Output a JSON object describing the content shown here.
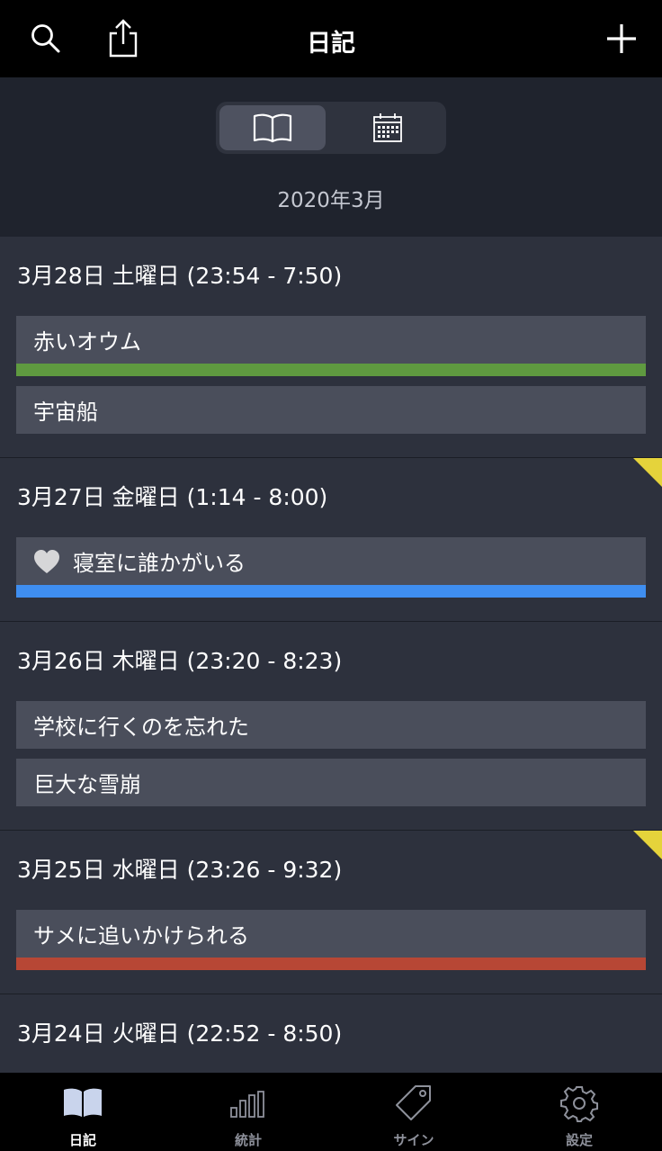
{
  "nav": {
    "title": "日記"
  },
  "header": {
    "month": "2020年3月"
  },
  "days": [
    {
      "title": "3月28日 土曜日 (23:54 - 7:50)",
      "flag": false,
      "dreams": [
        {
          "label": "赤いオウム",
          "bar_color": "#5f9a40",
          "heart": false
        },
        {
          "label": "宇宙船",
          "bar_color": null,
          "heart": false
        }
      ]
    },
    {
      "title": "3月27日 金曜日 (1:14 - 8:00)",
      "flag": true,
      "dreams": [
        {
          "label": "寝室に誰かがいる",
          "bar_color": "#3f8ef0",
          "heart": true
        }
      ]
    },
    {
      "title": "3月26日 木曜日 (23:20 - 8:23)",
      "flag": false,
      "dreams": [
        {
          "label": "学校に行くのを忘れた",
          "bar_color": null,
          "heart": false
        },
        {
          "label": "巨大な雪崩",
          "bar_color": null,
          "heart": false
        }
      ]
    },
    {
      "title": "3月25日 水曜日 (23:26 - 9:32)",
      "flag": true,
      "dreams": [
        {
          "label": "サメに追いかけられる",
          "bar_color": "#b74735",
          "heart": false
        }
      ]
    },
    {
      "title": "3月24日 火曜日 (22:52 - 8:50)",
      "flag": false,
      "dreams": []
    }
  ],
  "colors": {
    "flag": "#e5d33b",
    "accent_tab": "#c9d4ec"
  },
  "tabs": [
    {
      "label": "日記",
      "icon": "book-icon",
      "active": true
    },
    {
      "label": "統計",
      "icon": "bar-chart-icon",
      "active": false
    },
    {
      "label": "サイン",
      "icon": "tag-icon",
      "active": false
    },
    {
      "label": "設定",
      "icon": "gear-icon",
      "active": false
    }
  ]
}
